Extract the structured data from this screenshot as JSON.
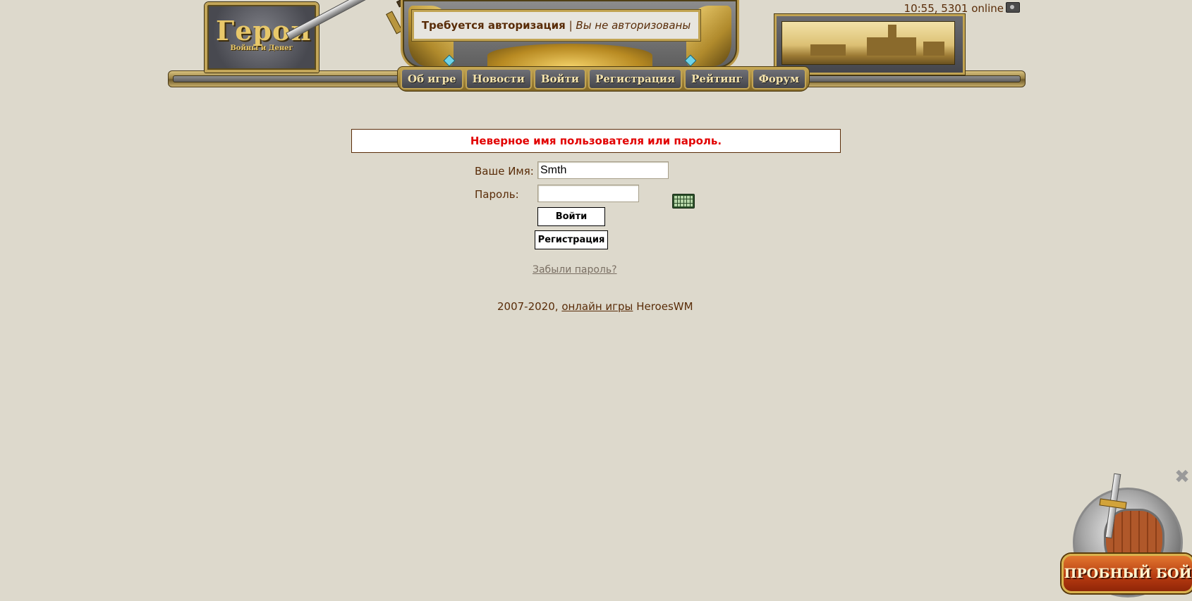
{
  "header": {
    "logo_title": "Герои",
    "logo_subtitle": "Войны и Денег",
    "auth_status": "Требуется авторизация",
    "auth_separator": "|",
    "auth_note": "Вы не авторизованы",
    "clock_text": "10:55, 5301 online",
    "nav": [
      "Об игре",
      "Новости",
      "Войти",
      "Регистрация",
      "Рейтинг",
      "Форум"
    ]
  },
  "login": {
    "error_message": "Неверное имя пользователя или пароль.",
    "name_label": "Ваше Имя:",
    "name_value": "Smth",
    "password_label": "Пароль:",
    "password_value": "",
    "login_button": "Войти",
    "register_button": "Регистрация",
    "forgot_link": "Забыли пароль?"
  },
  "footer": {
    "years": "2007-2020,",
    "link_text": "онлайн игры",
    "brand": "HeroesWM"
  },
  "trial_widget": {
    "button_label": "ПРОБНЫЙ БОЙ",
    "close_glyph": "✖"
  },
  "colors": {
    "background": "#ddd9cc",
    "text": "#592c08",
    "error": "#e20000",
    "gold": "#c2a453"
  },
  "icons": [
    "logo-sword-icon",
    "camera-icon",
    "virtual-keyboard-icon",
    "close-icon",
    "shield-sword-icon"
  ]
}
